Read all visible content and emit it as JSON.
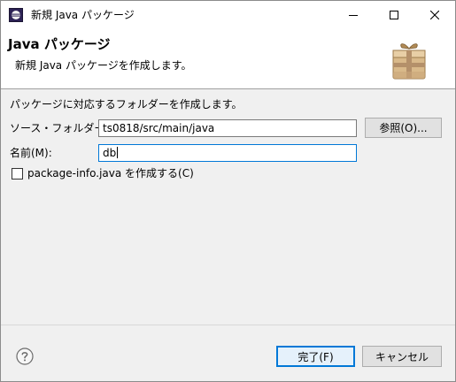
{
  "window": {
    "title": "新規 Java パッケージ",
    "minimize_glyph": "—",
    "maximize_glyph": "☐",
    "close_glyph": "✕"
  },
  "banner": {
    "title": "Java パッケージ",
    "message": "新規 Java パッケージを作成します。",
    "icon": "package-icon"
  },
  "form": {
    "description": "パッケージに対応するフォルダーを作成します。",
    "source_folder_label": "ソース・フォルダー(D):",
    "source_folder_value": "ts0818/src/main/java",
    "browse_label": "参照(O)...",
    "name_label": "名前(M):",
    "name_value": "db",
    "create_package_info_label": "package-info.java を作成する(C)",
    "create_package_info_checked": false
  },
  "footer": {
    "help_icon": "help-icon",
    "finish_label": "完了(F)",
    "cancel_label": "キャンセル"
  },
  "colors": {
    "accent": "#0078d7",
    "dialog_bg": "#f0f0f0",
    "banner_bg": "#ffffff"
  }
}
